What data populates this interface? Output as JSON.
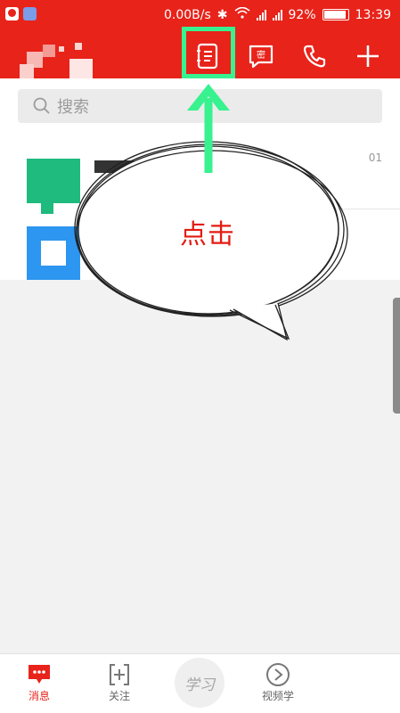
{
  "status_bar": {
    "network_speed": "0.00B/s",
    "battery": "92%",
    "time": "13:39",
    "bluetooth_icon": "bluetooth-icon",
    "wifi_icon": "wifi-icon"
  },
  "toolbar": {
    "contacts_icon": "address-book-icon",
    "secret_chat_icon": "secret-chat-icon",
    "secret_chat_glyph": "密",
    "call_icon": "phone-icon",
    "add_icon": "plus-icon"
  },
  "search": {
    "placeholder": "搜索"
  },
  "list": {
    "row_time": "01"
  },
  "annotation": {
    "text": "点击",
    "arrow_color": "#38f28f",
    "text_color": "#e31b12"
  },
  "bottom_nav": {
    "items": [
      {
        "label": "消息",
        "icon": "message-icon",
        "active": true
      },
      {
        "label": "关注",
        "icon": "follow-icon",
        "active": false
      },
      {
        "label": "学习",
        "icon": "study-logo",
        "active": false
      },
      {
        "label": "视频学",
        "icon": "play-icon",
        "active": false
      }
    ]
  },
  "colors": {
    "brand": "#e8231a",
    "highlight": "#38f28f",
    "search_bg": "#ebebeb"
  }
}
